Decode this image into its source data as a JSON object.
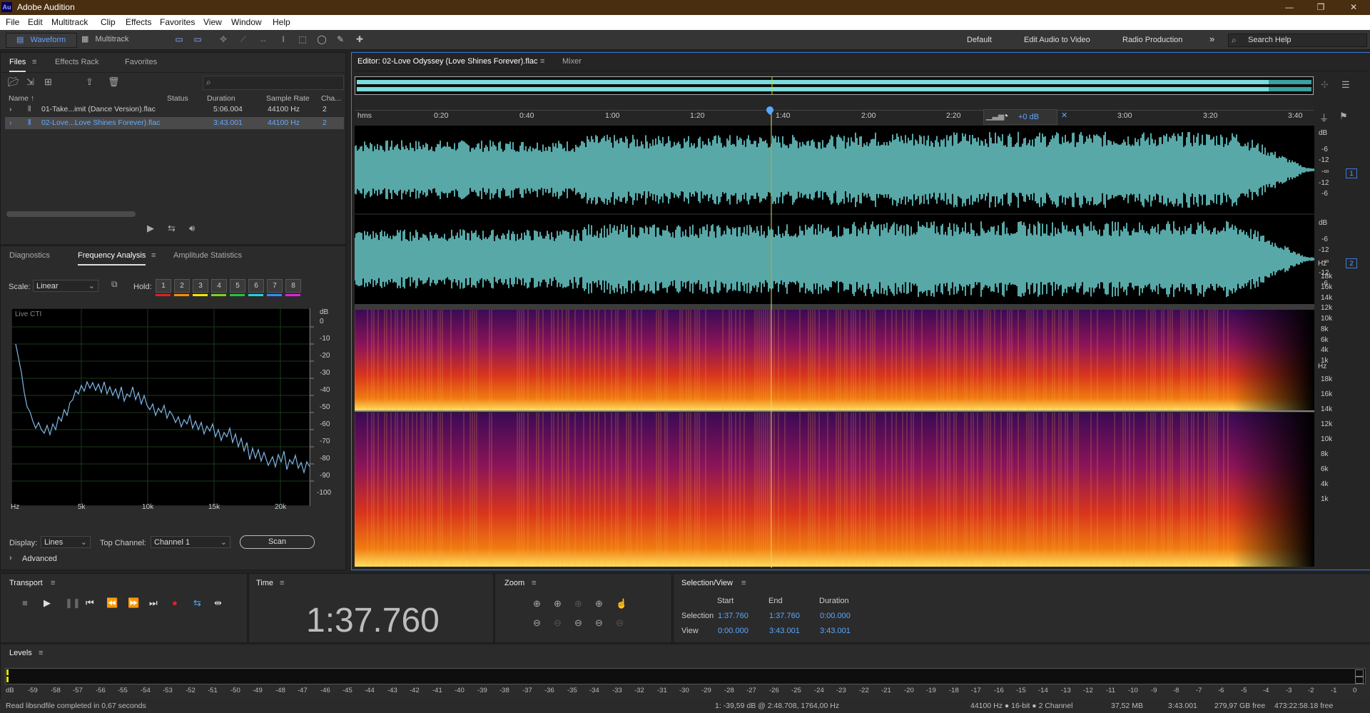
{
  "app": {
    "title": "Adobe Audition",
    "logo": "Au"
  },
  "menu": [
    "File",
    "Edit",
    "Multitrack",
    "Clip",
    "Effects",
    "Favorites",
    "View",
    "Window",
    "Help"
  ],
  "toolbar": {
    "waveform": "Waveform",
    "multitrack": "Multitrack",
    "workspaces": [
      "Default",
      "Edit Audio to Video",
      "Radio Production"
    ],
    "more": "»",
    "search_placeholder": "Search Help"
  },
  "files_panel": {
    "tabs": [
      "Files",
      "Effects Rack",
      "Favorites"
    ],
    "search_placeholder": "",
    "columns": [
      "Name ↑",
      "Status",
      "Duration",
      "Sample Rate",
      "Cha..."
    ],
    "rows": [
      {
        "name": "01-Take...imit (Dance Version).flac",
        "status": "",
        "duration": "5:06.004",
        "rate": "44100 Hz",
        "ch": "2"
      },
      {
        "name": "02-Love...Love Shines Forever).flac",
        "status": "",
        "duration": "3:43.001",
        "rate": "44100 Hz",
        "ch": "2"
      }
    ]
  },
  "analysis_panel": {
    "tabs": [
      "Diagnostics",
      "Frequency Analysis",
      "Amplitude Statistics"
    ],
    "scale_label": "Scale:",
    "scale_value": "Linear",
    "hold_label": "Hold:",
    "hold_buttons": [
      "1",
      "2",
      "3",
      "4",
      "5",
      "6",
      "7",
      "8"
    ],
    "hold_colors": [
      "#e02020",
      "#ff8c00",
      "#f2e600",
      "#7bd31e",
      "#27c43a",
      "#20d6d6",
      "#2f8cff",
      "#e020e0"
    ],
    "graph_label": "Live CTI",
    "db_ticks": [
      "dB",
      "0",
      "-10",
      "-20",
      "-30",
      "-40",
      "-50",
      "-60",
      "-70",
      "-80",
      "-90",
      "-100"
    ],
    "hz_ticks": [
      "Hz",
      "5k",
      "10k",
      "15k",
      "20k"
    ],
    "display_label": "Display:",
    "display_value": "Lines",
    "top_channel_label": "Top Channel:",
    "top_channel_value": "Channel 1",
    "scan_label": "Scan",
    "advanced_label": "Advanced"
  },
  "editor": {
    "tab_label": "Editor: 02-Love Odyssey (Love Shines Forever).flac",
    "mixer_label": "Mixer",
    "ruler": [
      "hms",
      "0:20",
      "0:40",
      "1:00",
      "1:20",
      "1:40",
      "2:00",
      "2:20",
      "3:00",
      "3:20",
      "3:40"
    ],
    "gain_label": "+0 dB",
    "playhead_fraction": 0.4379,
    "channel_db_ticks": [
      "dB",
      "-6",
      "-12",
      "-∞",
      "-12",
      "-6"
    ],
    "channel_labels": [
      "1",
      "2"
    ],
    "hz_ticks": [
      "Hz",
      "18k",
      "16k",
      "14k",
      "12k",
      "10k",
      "8k",
      "6k",
      "4k",
      "1k"
    ]
  },
  "transport": {
    "title": "Transport"
  },
  "time_panel": {
    "title": "Time",
    "value": "1:37.760"
  },
  "zoom_panel": {
    "title": "Zoom"
  },
  "selection_panel": {
    "title": "Selection/View",
    "headers": [
      "Start",
      "End",
      "Duration"
    ],
    "selection_label": "Selection",
    "selection": [
      "1:37.760",
      "1:37.760",
      "0:00.000"
    ],
    "view_label": "View",
    "view": [
      "0:00.000",
      "3:43.001",
      "3:43.001"
    ]
  },
  "levels": {
    "title": "Levels",
    "ticks": [
      "dB",
      "-59",
      "-58",
      "-57",
      "-56",
      "-55",
      "-54",
      "-53",
      "-52",
      "-51",
      "-50",
      "-49",
      "-48",
      "-47",
      "-46",
      "-45",
      "-44",
      "-43",
      "-42",
      "-41",
      "-40",
      "-39",
      "-38",
      "-37",
      "-36",
      "-35",
      "-34",
      "-33",
      "-32",
      "-31",
      "-30",
      "-29",
      "-28",
      "-27",
      "-26",
      "-25",
      "-24",
      "-23",
      "-22",
      "-21",
      "-20",
      "-19",
      "-18",
      "-17",
      "-16",
      "-15",
      "-14",
      "-13",
      "-12",
      "-11",
      "-10",
      "-9",
      "-8",
      "-7",
      "-6",
      "-5",
      "-4",
      "-3",
      "-2",
      "-1",
      "0"
    ]
  },
  "status": {
    "message": "Read libsndfile completed in 0,67 seconds",
    "cursor": "1: -39,59 dB @ 2:48.708, 1764,00 Hz",
    "format": "44100 Hz ● 16-bit ● 2 Channel",
    "size": "37,52 MB",
    "duration": "3:43.001",
    "free": "279,97 GB free",
    "free_time": "473:22:58.18 free"
  }
}
